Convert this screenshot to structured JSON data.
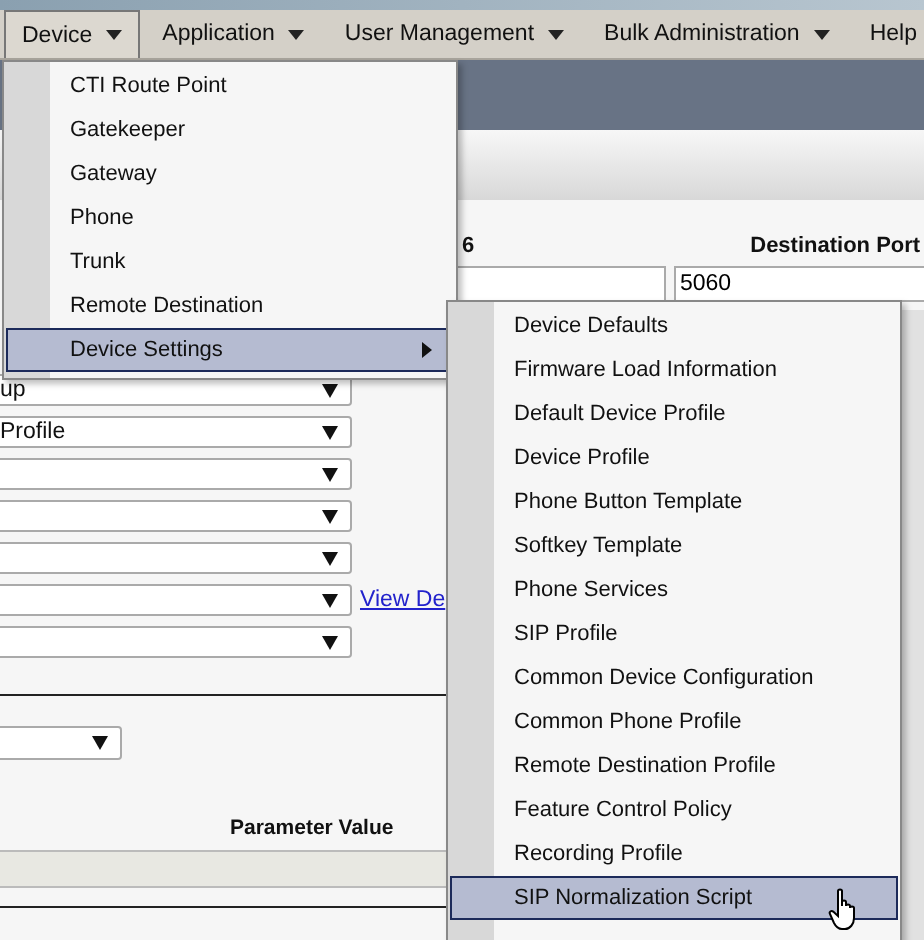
{
  "menubar": [
    {
      "label": "Device",
      "selected": true
    },
    {
      "label": "Application",
      "selected": false
    },
    {
      "label": "User Management",
      "selected": false
    },
    {
      "label": "Bulk Administration",
      "selected": false
    },
    {
      "label": "Help",
      "selected": false
    }
  ],
  "form": {
    "label_fragment": "6",
    "destination_port_label": "Destination Port",
    "destination_port_value": "5060",
    "selects": [
      {
        "kind": "dropdown",
        "value": "up"
      },
      {
        "kind": "dropdown",
        "value": "Profile"
      },
      {
        "kind": "dropdown"
      },
      {
        "kind": "dropdown"
      },
      {
        "kind": "dropdown"
      },
      {
        "kind": "dropdown",
        "link": "View De"
      },
      {
        "kind": "dropdown"
      }
    ],
    "parameter_value_header": "Parameter Value"
  },
  "device_menu": [
    {
      "label": "CTI Route Point",
      "selected": false,
      "has_submenu": false
    },
    {
      "label": "Gatekeeper",
      "selected": false,
      "has_submenu": false
    },
    {
      "label": "Gateway",
      "selected": false,
      "has_submenu": false
    },
    {
      "label": "Phone",
      "selected": false,
      "has_submenu": false
    },
    {
      "label": "Trunk",
      "selected": false,
      "has_submenu": false
    },
    {
      "label": "Remote Destination",
      "selected": false,
      "has_submenu": false
    },
    {
      "label": "Device Settings",
      "selected": true,
      "has_submenu": true
    }
  ],
  "device_settings_menu": [
    {
      "label": "Device Defaults",
      "selected": false
    },
    {
      "label": "Firmware Load Information",
      "selected": false
    },
    {
      "label": "Default Device Profile",
      "selected": false
    },
    {
      "label": "Device Profile",
      "selected": false
    },
    {
      "label": "Phone Button Template",
      "selected": false
    },
    {
      "label": "Softkey Template",
      "selected": false
    },
    {
      "label": "Phone Services",
      "selected": false
    },
    {
      "label": "SIP Profile",
      "selected": false
    },
    {
      "label": "Common Device Configuration",
      "selected": false
    },
    {
      "label": "Common Phone Profile",
      "selected": false
    },
    {
      "label": "Remote Destination Profile",
      "selected": false
    },
    {
      "label": "Feature Control Policy",
      "selected": false
    },
    {
      "label": "Recording Profile",
      "selected": false
    },
    {
      "label": "SIP Normalization Script",
      "selected": true
    }
  ]
}
